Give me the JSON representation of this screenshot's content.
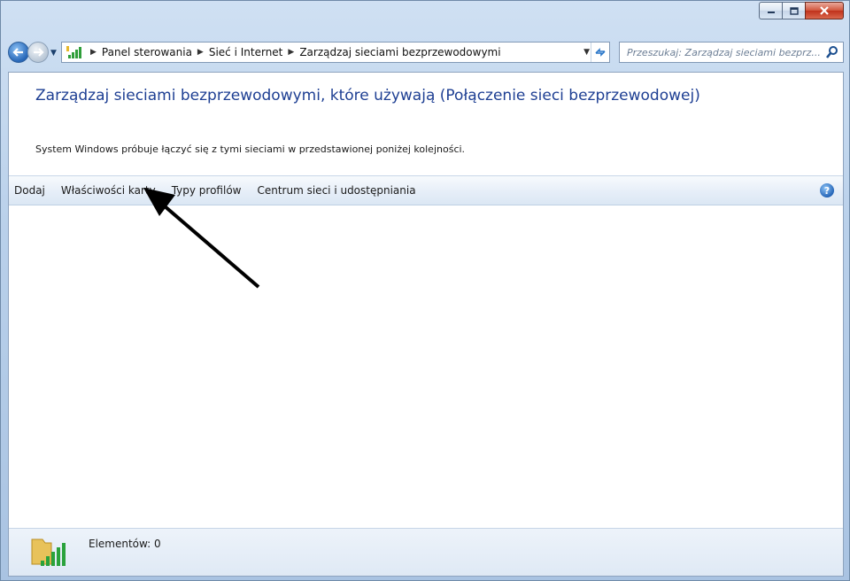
{
  "window": {
    "minimize_icon": "minimize-icon",
    "maximize_icon": "maximize-icon",
    "close_icon": "close-icon"
  },
  "nav": {
    "back_icon": "back-arrow-icon",
    "forward_icon": "forward-arrow-icon",
    "breadcrumbs": [
      "Panel sterowania",
      "Sieć i Internet",
      "Zarządzaj sieciami bezprzewodowymi"
    ],
    "search_placeholder": "Przeszukaj: Zarządzaj sieciami bezprz..."
  },
  "main": {
    "title": "Zarządzaj sieciami bezprzewodowymi, które używają (Połączenie sieci bezprzewodowej)",
    "subtitle": "System Windows próbuje łączyć się z tymi sieciami w przedstawionej poniżej kolejności."
  },
  "toolbar": {
    "items": [
      "Dodaj",
      "Właściwości karty",
      "Typy profilów",
      "Centrum sieci i udostępniania"
    ]
  },
  "status": {
    "count_label": "Elementów: 0"
  },
  "colors": {
    "title": "#1e3f93",
    "accent": "#2767b8"
  }
}
